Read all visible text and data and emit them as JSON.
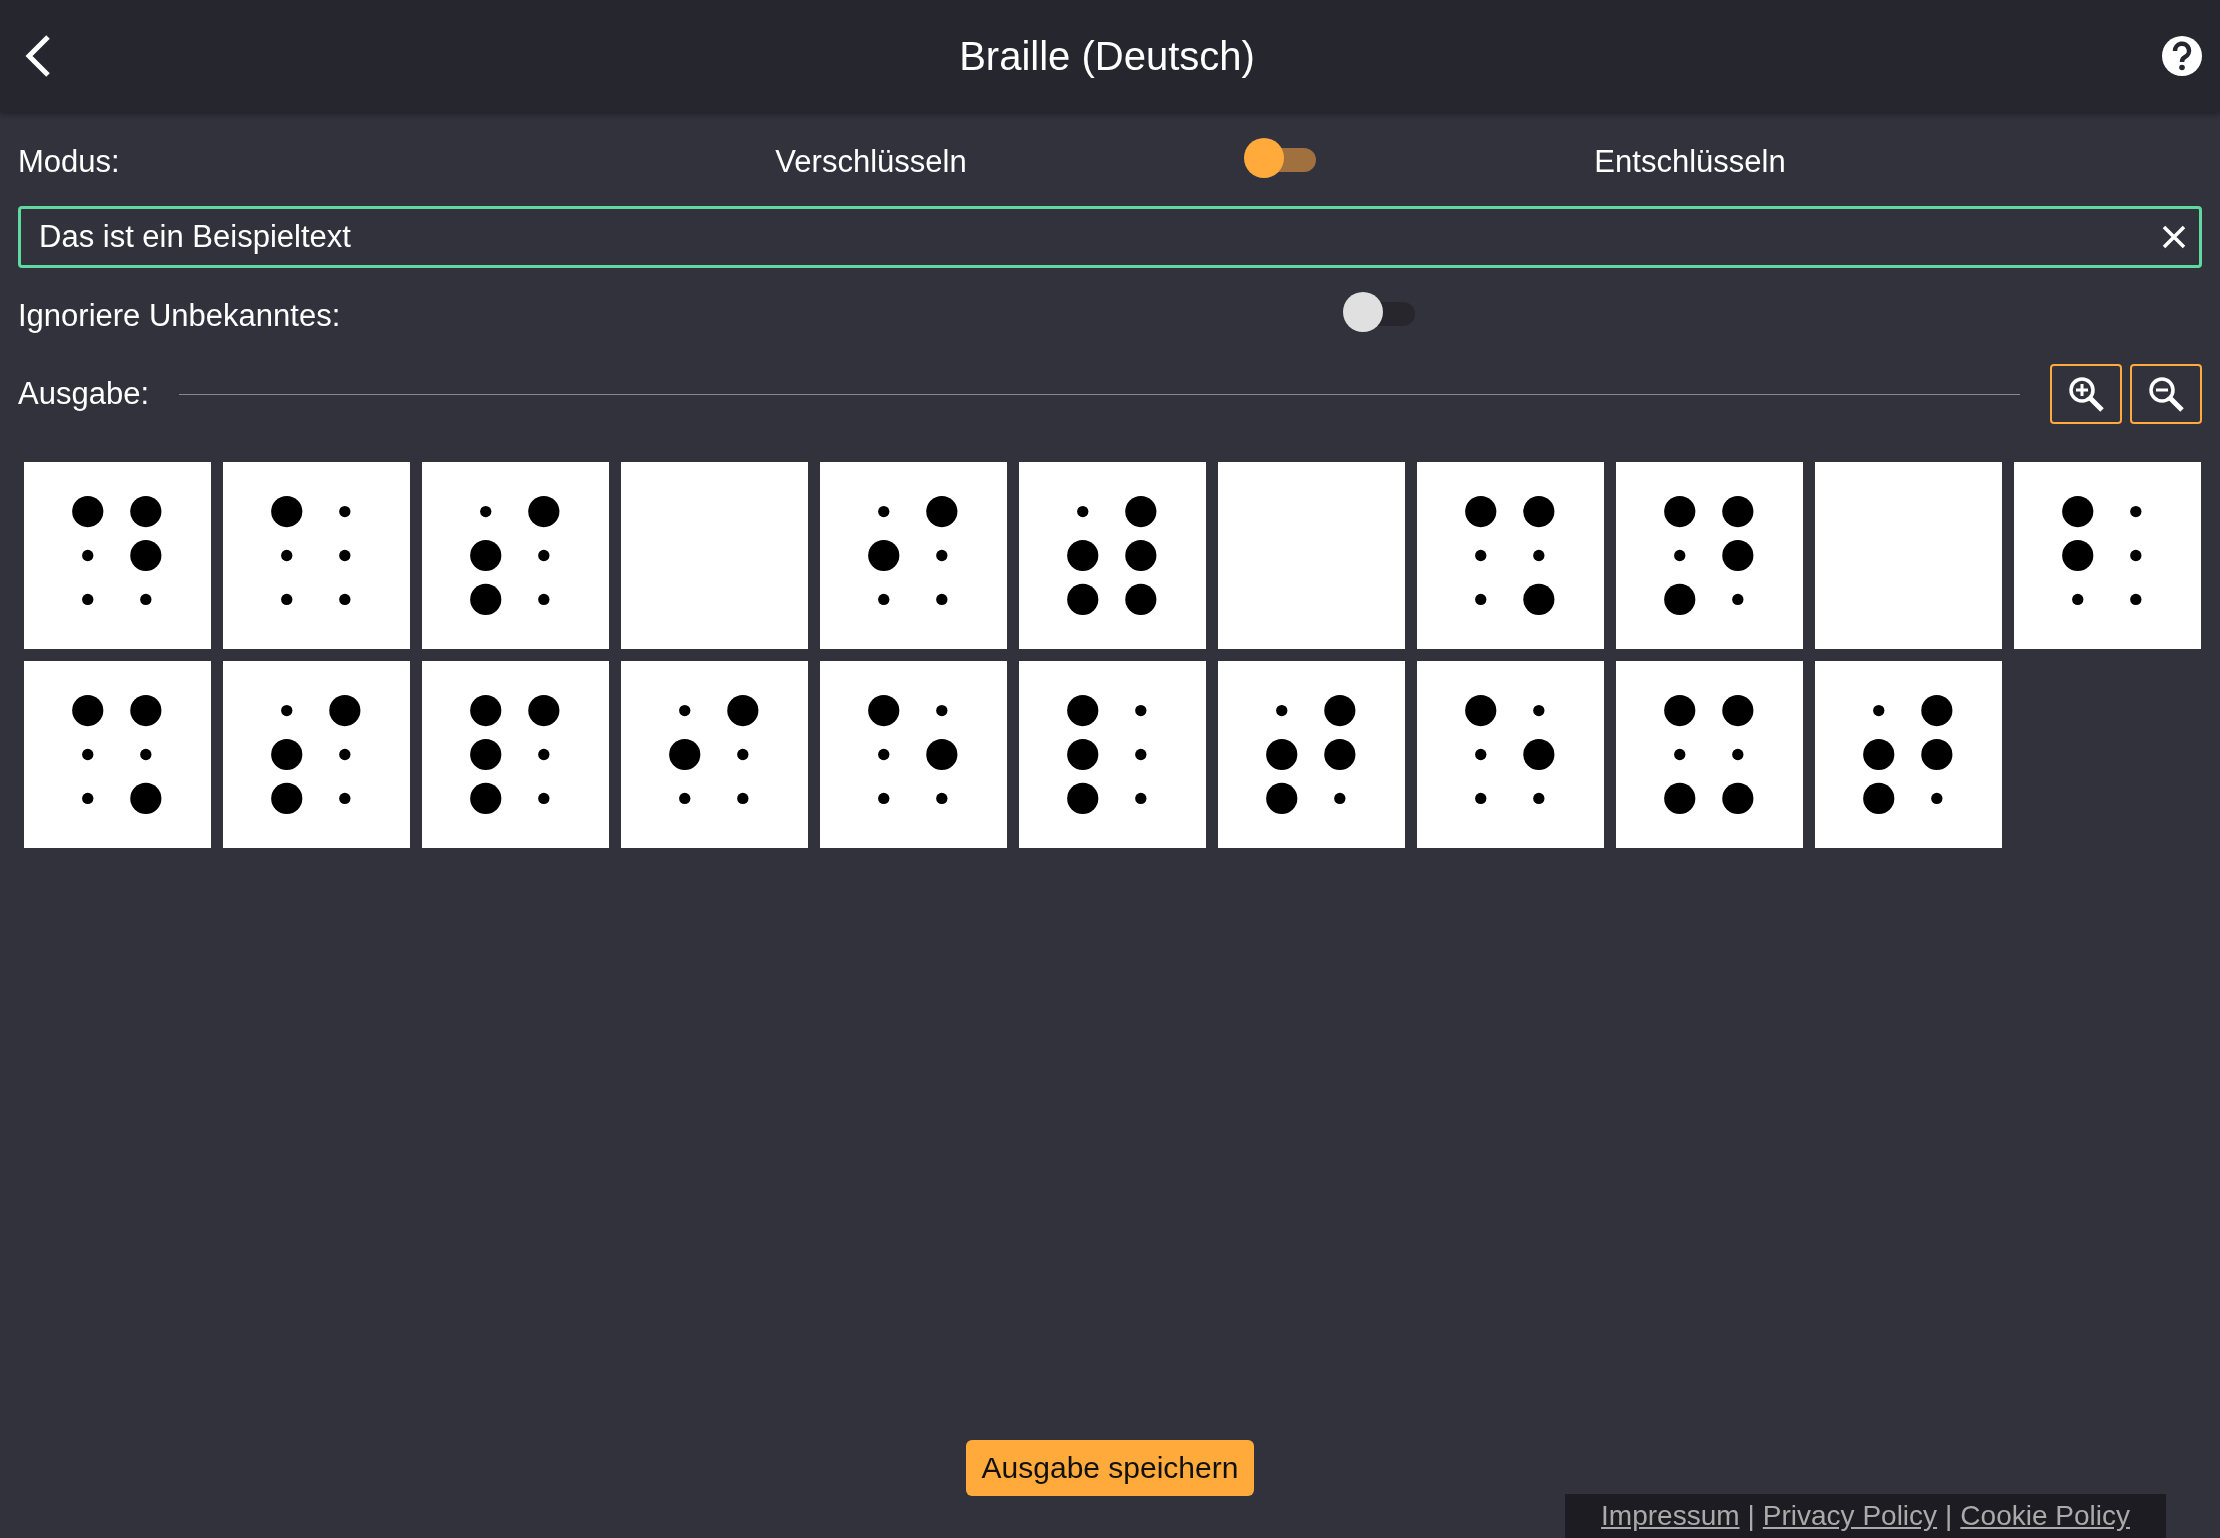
{
  "header": {
    "title": "Braille (Deutsch)"
  },
  "mode": {
    "label": "Modus:",
    "option_left": "Verschlüsseln",
    "option_right": "Entschlüsseln",
    "on": true
  },
  "input": {
    "value": "Das ist ein Beispieltext"
  },
  "ignore_unknown": {
    "label": "Ignoriere Unbekanntes:",
    "on": false
  },
  "output": {
    "label": "Ausgabe:"
  },
  "cells": [
    {
      "kind": "letter",
      "dots": [
        true,
        false,
        false,
        true,
        true,
        false
      ]
    },
    {
      "kind": "letter",
      "dots": [
        true,
        false,
        false,
        false,
        false,
        false
      ]
    },
    {
      "kind": "letter",
      "dots": [
        false,
        true,
        true,
        true,
        false,
        false
      ]
    },
    {
      "kind": "space"
    },
    {
      "kind": "letter",
      "dots": [
        false,
        true,
        false,
        true,
        false,
        false
      ]
    },
    {
      "kind": "letter",
      "dots": [
        false,
        true,
        true,
        true,
        true,
        true
      ]
    },
    {
      "kind": "space"
    },
    {
      "kind": "letter",
      "dots": [
        true,
        false,
        false,
        true,
        false,
        true
      ]
    },
    {
      "kind": "letter",
      "dots": [
        true,
        false,
        true,
        true,
        true,
        false
      ]
    },
    {
      "kind": "space"
    },
    {
      "kind": "letter",
      "dots": [
        true,
        true,
        false,
        false,
        false,
        false
      ]
    },
    {
      "kind": "letter",
      "dots": [
        true,
        false,
        false,
        true,
        false,
        true
      ]
    },
    {
      "kind": "letter",
      "dots": [
        false,
        true,
        true,
        true,
        false,
        false
      ]
    },
    {
      "kind": "letter",
      "dots": [
        true,
        true,
        true,
        true,
        false,
        false
      ]
    },
    {
      "kind": "letter",
      "dots": [
        false,
        true,
        false,
        true,
        false,
        false
      ]
    },
    {
      "kind": "letter",
      "dots": [
        true,
        false,
        false,
        false,
        true,
        false
      ]
    },
    {
      "kind": "letter",
      "dots": [
        true,
        true,
        true,
        false,
        false,
        false
      ]
    },
    {
      "kind": "letter",
      "dots": [
        false,
        true,
        true,
        true,
        true,
        false
      ]
    },
    {
      "kind": "letter",
      "dots": [
        true,
        false,
        false,
        false,
        true,
        false
      ]
    },
    {
      "kind": "letter",
      "dots": [
        true,
        false,
        true,
        true,
        false,
        true
      ]
    },
    {
      "kind": "letter",
      "dots": [
        false,
        true,
        true,
        true,
        true,
        false
      ]
    }
  ],
  "save_button": "Ausgabe speichern",
  "footer": [
    {
      "kind": "link",
      "label": "Impressum"
    },
    {
      "kind": "separator",
      "label": "|"
    },
    {
      "kind": "link",
      "label": "Privacy Policy"
    },
    {
      "kind": "separator",
      "label": "|"
    },
    {
      "kind": "link",
      "label": "Cookie Policy"
    }
  ]
}
